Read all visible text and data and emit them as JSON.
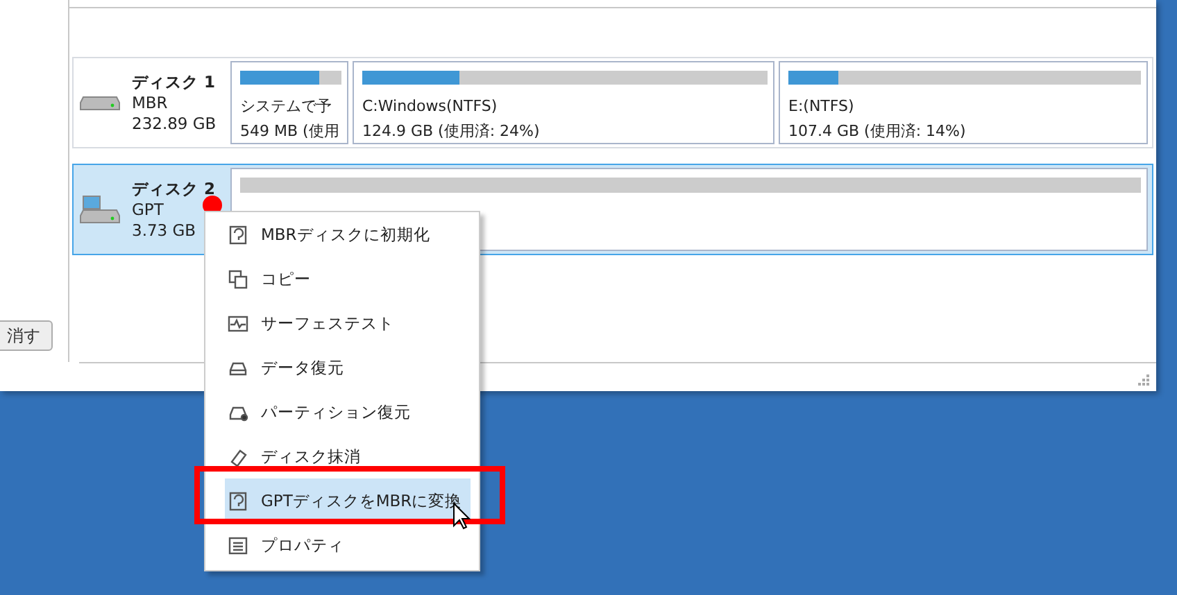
{
  "sidebar": {
    "button": "消す"
  },
  "disks": [
    {
      "name": "ディスク 1",
      "style": "MBR",
      "size": "232.89 GB",
      "selected": false,
      "partitions": [
        {
          "name": "システムで予",
          "usage": "549 MB (使用",
          "level": 0.78
        },
        {
          "name": "C:Windows(NTFS)",
          "usage": "124.9 GB (使用済: 24%)",
          "level": 0.24
        },
        {
          "name": "E:(NTFS)",
          "usage": "107.4 GB (使用済: 14%)",
          "level": 0.14
        }
      ]
    },
    {
      "name": "ディスク 2",
      "style": "GPT",
      "size": "3.73 GB",
      "selected": true,
      "partitions": [
        {
          "kind": "unallocated"
        }
      ]
    }
  ],
  "context_menu": {
    "items": [
      {
        "kind": "init",
        "label": "MBRディスクに初期化",
        "selected": false
      },
      {
        "kind": "copy",
        "label": "コピー",
        "selected": false
      },
      {
        "kind": "surface",
        "label": "サーフェステスト",
        "selected": false
      },
      {
        "kind": "drive",
        "label": "データ復元",
        "selected": false
      },
      {
        "kind": "drive-dot",
        "label": "パーティション復元",
        "selected": false
      },
      {
        "kind": "eraser",
        "label": "ディスク抹消",
        "selected": false
      },
      {
        "kind": "init",
        "label": "GPTディスクをMBRに変換",
        "selected": true
      },
      {
        "kind": "list",
        "label": "プロパティ",
        "selected": false
      }
    ]
  }
}
